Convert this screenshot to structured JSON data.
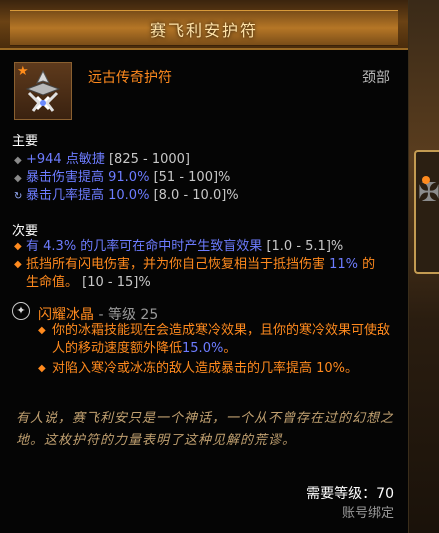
{
  "item": {
    "name": "赛飞利安护符",
    "type": "远古传奇护符",
    "slot": "颈部"
  },
  "primary": {
    "title": "主要",
    "stats": [
      {
        "text": "+944 点敏捷",
        "range": "[825 - 1000]"
      },
      {
        "text": "暴击伤害提高 91.0%",
        "range": "[51 - 100]%"
      },
      {
        "text": "暴击几率提高 10.0%",
        "range": "[8.0 - 10.0]%"
      }
    ]
  },
  "secondary": {
    "title": "次要",
    "stats": [
      {
        "pre": "有 ",
        "val": "4.3%",
        "post": " 的几率可在命中时产生致盲效果",
        "range": " [1.0 - 5.1]%"
      },
      {
        "pre": "抵挡所有闪电伤害，并为你自己恢复相当于抵挡伤害 ",
        "val": "11%",
        "post": " 的生命值。",
        "range": " [10 - 15]%"
      }
    ]
  },
  "set": {
    "name": "闪耀冰晶",
    "level_prefix": " - 等级 ",
    "level": "25",
    "effects": [
      {
        "pre": "你的冰霜技能现在会造成寒冷效果，且你的寒冷效果可使敌人的移动速度额外降低",
        "val": "15.0%",
        "post": "。"
      },
      {
        "pre": "对陷入寒冷或冰冻的敌人造成暴击的几率提高 ",
        "val": "10%",
        "post": "。"
      }
    ]
  },
  "flavor": "有人说，赛飞利安只是一个神话，一个从不曾存在过的幻想之地。这枚护符的力量表明了这种见解的荒谬。",
  "footer": {
    "required_level": "需要等级：70",
    "binding": "账号绑定"
  },
  "colors": {
    "legendary_orange": "#ff8a1e",
    "magic_blue": "#6d7cff",
    "range_gray": "#c8c8c8"
  }
}
